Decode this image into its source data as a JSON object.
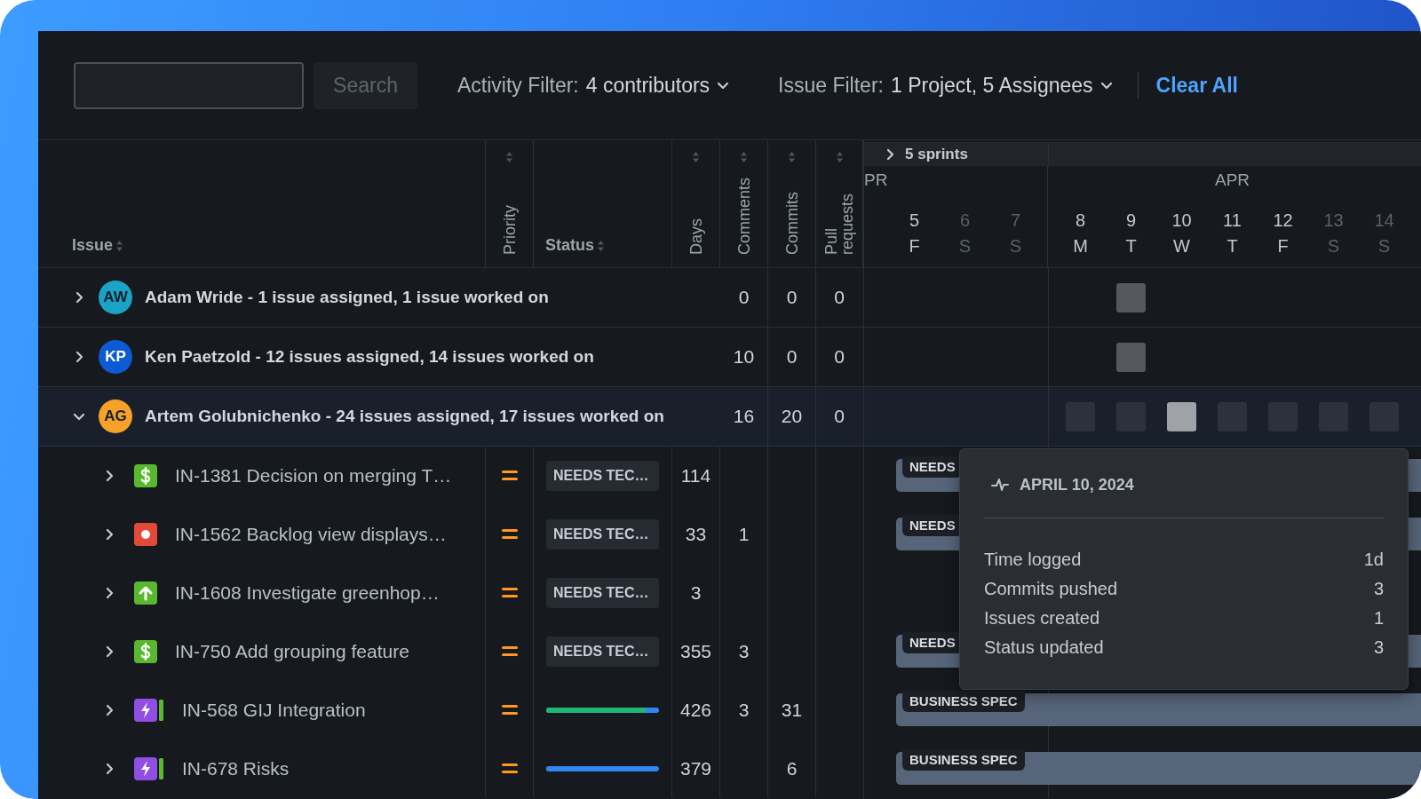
{
  "toolbar": {
    "search_button": "Search",
    "filters": [
      {
        "label": "Activity Filter:",
        "value": "4 contributors"
      },
      {
        "label": "Issue Filter:",
        "value": "1 Project, 5 Assignees"
      }
    ],
    "clear": "Clear All"
  },
  "table": {
    "columns": [
      {
        "label": "Issue",
        "kind": "inline"
      },
      {
        "label": "Priority",
        "kind": "vertical"
      },
      {
        "label": "Status",
        "kind": "inline"
      },
      {
        "label": "Days",
        "kind": "vertical"
      },
      {
        "label": "Comments",
        "kind": "vertical"
      },
      {
        "label": "Commits",
        "kind": "vertical"
      },
      {
        "label": "Pull requests",
        "kind": "vertical"
      }
    ]
  },
  "timeline": {
    "sprints": "5 sprints",
    "sprints_expanded": false,
    "weeks": [
      {
        "month": "PR",
        "days": [
          {
            "date": "5",
            "weekday": "F",
            "weekend": false
          },
          {
            "date": "6",
            "weekday": "S",
            "weekend": true
          },
          {
            "date": "7",
            "weekday": "S",
            "weekend": true
          }
        ]
      },
      {
        "month": "APR",
        "days": [
          {
            "date": "8",
            "weekday": "M",
            "weekend": false
          },
          {
            "date": "9",
            "weekday": "T",
            "weekend": false
          },
          {
            "date": "10",
            "weekday": "W",
            "weekend": false
          },
          {
            "date": "11",
            "weekday": "T",
            "weekend": false
          },
          {
            "date": "12",
            "weekday": "F",
            "weekend": false
          },
          {
            "date": "13",
            "weekday": "S",
            "weekend": true
          },
          {
            "date": "14",
            "weekday": "S",
            "weekend": true
          }
        ]
      }
    ]
  },
  "groups": [
    {
      "initials": "AW",
      "color": "#1ba3c6",
      "title": "Adam Wride - 1 issue assigned, 1 issue worked on",
      "expanded": false,
      "comments": "0",
      "commits": "0",
      "pull_requests": "0",
      "activity": [
        {
          "active": false
        },
        {
          "active": false
        },
        {
          "active": false
        },
        {
          "active": false
        },
        {
          "active": true,
          "selected": false
        },
        {
          "active": false
        },
        {
          "active": false
        },
        {
          "active": false
        },
        {
          "active": false
        },
        {
          "active": false
        }
      ]
    },
    {
      "initials": "KP",
      "color": "#0c5bd4",
      "title": "Ken Paetzold - 12 issues assigned, 14 issues worked on",
      "expanded": false,
      "comments": "10",
      "commits": "0",
      "pull_requests": "0",
      "activity": [
        {
          "active": false
        },
        {
          "active": false
        },
        {
          "active": false
        },
        {
          "active": false
        },
        {
          "active": true,
          "selected": false
        },
        {
          "active": false
        },
        {
          "active": false
        },
        {
          "active": false
        },
        {
          "active": false
        },
        {
          "active": false
        }
      ]
    },
    {
      "initials": "AG",
      "color": "#f7a128",
      "title": "Artem Golubnichenko - 24 issues assigned, 17 issues worked on",
      "expanded": true,
      "comments": "16",
      "commits": "20",
      "pull_requests": "0",
      "activity": [
        {
          "active": false
        },
        {
          "active": false
        },
        {
          "active": false
        },
        {
          "active": true,
          "selected": false
        },
        {
          "active": true,
          "selected": false
        },
        {
          "active": true,
          "selected": true
        },
        {
          "active": true,
          "selected": false
        },
        {
          "active": true,
          "selected": false
        },
        {
          "active": true,
          "selected": false
        },
        {
          "active": true,
          "selected": false
        }
      ],
      "children": [
        {
          "kind": "story",
          "title": "IN-1381 Decision on merging T…",
          "expanded": false,
          "priority": {
            "kind": "medium"
          },
          "status": {
            "kind": "badge",
            "text": "NEEDS TEC…"
          },
          "days": "114",
          "bar": {
            "label": "NEEDS"
          }
        },
        {
          "kind": "bug",
          "title": "IN-1562 Backlog view displays…",
          "expanded": false,
          "priority": {
            "kind": "medium"
          },
          "status": {
            "kind": "badge",
            "text": "NEEDS TEC…"
          },
          "days": "33",
          "comments": "1",
          "bar": {
            "label": "NEEDS"
          }
        },
        {
          "kind": "improvement",
          "title": "IN-1608 Investigate greenhop…",
          "expanded": false,
          "priority": {
            "kind": "medium"
          },
          "status": {
            "kind": "badge",
            "text": "NEEDS TEC…"
          },
          "days": "3"
        },
        {
          "kind": "story",
          "title": "IN-750 Add grouping feature",
          "expanded": false,
          "priority": {
            "kind": "medium"
          },
          "status": {
            "kind": "badge",
            "text": "NEEDS TEC…"
          },
          "days": "355",
          "comments": "3",
          "bar": {
            "label": "NEEDS"
          }
        },
        {
          "kind": "epic",
          "title": "IN-568 GIJ Integration",
          "expanded": false,
          "priority": {
            "kind": "medium"
          },
          "status": {
            "kind": "progress",
            "level": 0.88
          },
          "days": "426",
          "comments": "3",
          "commits": "31",
          "bar": {
            "label": "BUSINESS SPEC"
          }
        },
        {
          "kind": "epic",
          "title": "IN-678 Risks",
          "expanded": false,
          "priority": {
            "kind": "medium"
          },
          "status": {
            "kind": "progress",
            "level": 0
          },
          "days": "379",
          "commits": "6",
          "bar": {
            "label": "BUSINESS SPEC"
          }
        }
      ]
    }
  ],
  "tooltip": {
    "date": "APRIL 10, 2024",
    "stats": [
      {
        "label": "Time logged",
        "value": "1d"
      },
      {
        "label": "Commits pushed",
        "value": "3"
      },
      {
        "label": "Issues created",
        "value": "1"
      },
      {
        "label": "Status updated",
        "value": "3"
      }
    ]
  }
}
